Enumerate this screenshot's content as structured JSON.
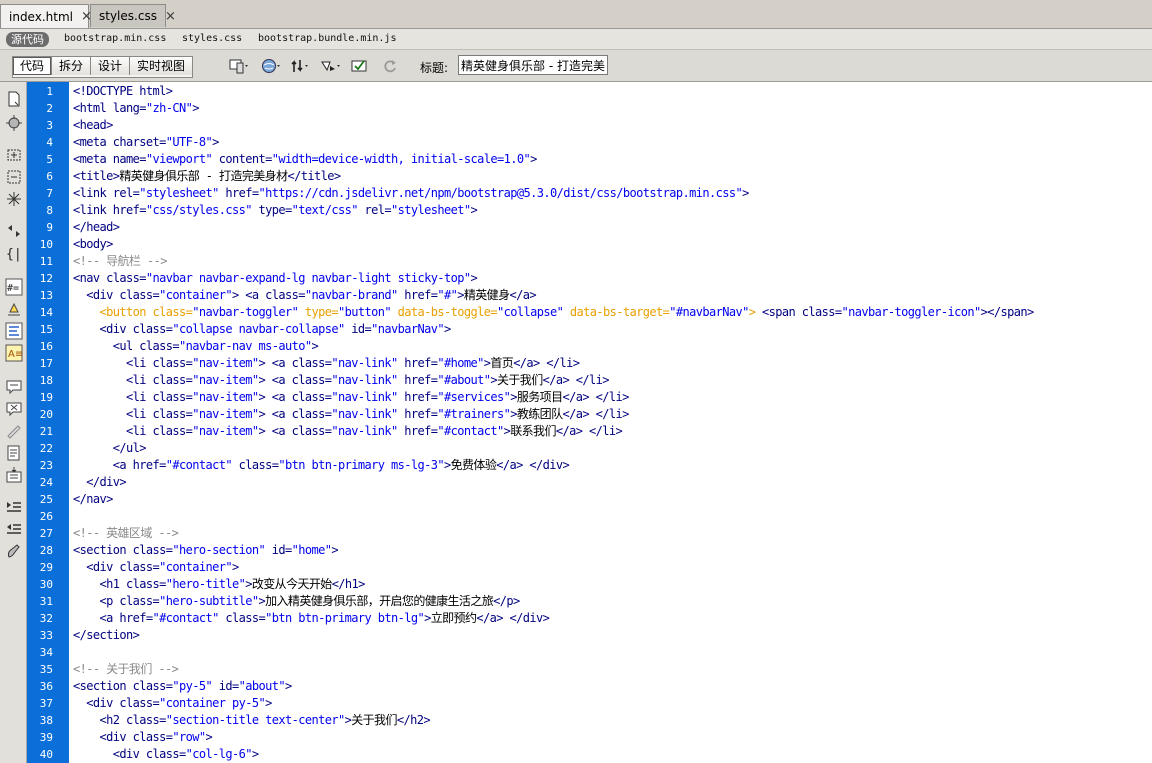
{
  "tabs": [
    {
      "label": "index.html",
      "close": "×",
      "active": true
    },
    {
      "label": "styles.css",
      "close": "×",
      "active": false
    }
  ],
  "related": {
    "source_label": "源代码",
    "files": [
      "bootstrap.min.css",
      "styles.css",
      "bootstrap.bundle.min.js"
    ]
  },
  "toolbar": {
    "views": [
      "代码",
      "拆分",
      "设计",
      "实时视图"
    ],
    "active_view": "代码",
    "title_label": "标题:",
    "title_value": "精英健身俱乐部 - 打造完美身材"
  },
  "editor": {
    "line_numbers": [
      "1",
      "2",
      "3",
      "4",
      "5",
      "6",
      "7",
      "8",
      "9",
      "10",
      "11",
      "12",
      "13",
      "14",
      "15",
      "16",
      "17",
      "18",
      "19",
      "20",
      "21",
      "22",
      "23",
      "24",
      "25",
      "26",
      "27",
      "28",
      "29",
      "30",
      "31",
      "32",
      "33",
      "34",
      "35",
      "36",
      "37",
      "38",
      "39",
      "40"
    ],
    "lines": [
      [
        [
          "t",
          "<!DOCTYPE html>"
        ]
      ],
      [
        [
          "t",
          "<html "
        ],
        [
          "a",
          "lang="
        ],
        [
          "v",
          "\"zh-CN\""
        ],
        [
          "t",
          ">"
        ]
      ],
      [
        [
          "t",
          "<head>"
        ]
      ],
      [
        [
          "t",
          "<meta "
        ],
        [
          "a",
          "charset="
        ],
        [
          "v",
          "\"UTF-8\""
        ],
        [
          "t",
          ">"
        ]
      ],
      [
        [
          "t",
          "<meta "
        ],
        [
          "a",
          "name="
        ],
        [
          "v",
          "\"viewport\" "
        ],
        [
          "a",
          "content="
        ],
        [
          "v",
          "\"width=device-width, initial-scale=1.0\""
        ],
        [
          "t",
          ">"
        ]
      ],
      [
        [
          "t",
          "<title>"
        ],
        [
          "x",
          "精英健身俱乐部 - 打造完美身材"
        ],
        [
          "t",
          "</title>"
        ]
      ],
      [
        [
          "t",
          "<link "
        ],
        [
          "a",
          "rel="
        ],
        [
          "v",
          "\"stylesheet\" "
        ],
        [
          "a",
          "href="
        ],
        [
          "v",
          "\"https://cdn.jsdelivr.net/npm/bootstrap@5.3.0/dist/css/bootstrap.min.css\""
        ],
        [
          "t",
          ">"
        ]
      ],
      [
        [
          "t",
          "<link "
        ],
        [
          "a",
          "href="
        ],
        [
          "v",
          "\"css/styles.css\" "
        ],
        [
          "a",
          "type="
        ],
        [
          "v",
          "\"text/css\" "
        ],
        [
          "a",
          "rel="
        ],
        [
          "v",
          "\"stylesheet\""
        ],
        [
          "t",
          ">"
        ]
      ],
      [
        [
          "t",
          "</head>"
        ]
      ],
      [
        [
          "t",
          "<body>"
        ]
      ],
      [
        [
          "c",
          "<!-- 导航栏 -->"
        ]
      ],
      [
        [
          "t",
          "<nav "
        ],
        [
          "a",
          "class="
        ],
        [
          "v",
          "\"navbar navbar-expand-lg navbar-light sticky-top\""
        ],
        [
          "t",
          ">"
        ]
      ],
      [
        [
          "x",
          "  "
        ],
        [
          "t",
          "<div "
        ],
        [
          "a",
          "class="
        ],
        [
          "v",
          "\"container\""
        ],
        [
          "t",
          "> <a "
        ],
        [
          "a",
          "class="
        ],
        [
          "v",
          "\"navbar-brand\" "
        ],
        [
          "a",
          "href="
        ],
        [
          "v",
          "\"#\""
        ],
        [
          "t",
          ">"
        ],
        [
          "x",
          "精英健身"
        ],
        [
          "t",
          "</a>"
        ]
      ],
      [
        [
          "x",
          "    "
        ],
        [
          "o",
          "<button class="
        ],
        [
          "v",
          "\"navbar-toggler\" "
        ],
        [
          "o",
          "type="
        ],
        [
          "v",
          "\"button\" "
        ],
        [
          "o",
          "data-bs-toggle="
        ],
        [
          "v",
          "\"collapse\" "
        ],
        [
          "o",
          "data-bs-target="
        ],
        [
          "v",
          "\"#navbarNav\""
        ],
        [
          "o",
          ">"
        ],
        [
          "t",
          " <span "
        ],
        [
          "a",
          "class="
        ],
        [
          "v",
          "\"navbar-toggler-icon\""
        ],
        [
          "t",
          "></span>"
        ]
      ],
      [
        [
          "x",
          "    "
        ],
        [
          "t",
          "<div "
        ],
        [
          "a",
          "class="
        ],
        [
          "v",
          "\"collapse navbar-collapse\" "
        ],
        [
          "a",
          "id="
        ],
        [
          "v",
          "\"navbarNav\""
        ],
        [
          "t",
          ">"
        ]
      ],
      [
        [
          "x",
          "      "
        ],
        [
          "t",
          "<ul "
        ],
        [
          "a",
          "class="
        ],
        [
          "v",
          "\"navbar-nav ms-auto\""
        ],
        [
          "t",
          ">"
        ]
      ],
      [
        [
          "x",
          "        "
        ],
        [
          "t",
          "<li "
        ],
        [
          "a",
          "class="
        ],
        [
          "v",
          "\"nav-item\""
        ],
        [
          "t",
          "> <a "
        ],
        [
          "a",
          "class="
        ],
        [
          "v",
          "\"nav-link\" "
        ],
        [
          "a",
          "href="
        ],
        [
          "v",
          "\"#home\""
        ],
        [
          "t",
          ">"
        ],
        [
          "x",
          "首页"
        ],
        [
          "t",
          "</a> </li>"
        ]
      ],
      [
        [
          "x",
          "        "
        ],
        [
          "t",
          "<li "
        ],
        [
          "a",
          "class="
        ],
        [
          "v",
          "\"nav-item\""
        ],
        [
          "t",
          "> <a "
        ],
        [
          "a",
          "class="
        ],
        [
          "v",
          "\"nav-link\" "
        ],
        [
          "a",
          "href="
        ],
        [
          "v",
          "\"#about\""
        ],
        [
          "t",
          ">"
        ],
        [
          "x",
          "关于我们"
        ],
        [
          "t",
          "</a> </li>"
        ]
      ],
      [
        [
          "x",
          "        "
        ],
        [
          "t",
          "<li "
        ],
        [
          "a",
          "class="
        ],
        [
          "v",
          "\"nav-item\""
        ],
        [
          "t",
          "> <a "
        ],
        [
          "a",
          "class="
        ],
        [
          "v",
          "\"nav-link\" "
        ],
        [
          "a",
          "href="
        ],
        [
          "v",
          "\"#services\""
        ],
        [
          "t",
          ">"
        ],
        [
          "x",
          "服务项目"
        ],
        [
          "t",
          "</a> </li>"
        ]
      ],
      [
        [
          "x",
          "        "
        ],
        [
          "t",
          "<li "
        ],
        [
          "a",
          "class="
        ],
        [
          "v",
          "\"nav-item\""
        ],
        [
          "t",
          "> <a "
        ],
        [
          "a",
          "class="
        ],
        [
          "v",
          "\"nav-link\" "
        ],
        [
          "a",
          "href="
        ],
        [
          "v",
          "\"#trainers\""
        ],
        [
          "t",
          ">"
        ],
        [
          "x",
          "教练团队"
        ],
        [
          "t",
          "</a> </li>"
        ]
      ],
      [
        [
          "x",
          "        "
        ],
        [
          "t",
          "<li "
        ],
        [
          "a",
          "class="
        ],
        [
          "v",
          "\"nav-item\""
        ],
        [
          "t",
          "> <a "
        ],
        [
          "a",
          "class="
        ],
        [
          "v",
          "\"nav-link\" "
        ],
        [
          "a",
          "href="
        ],
        [
          "v",
          "\"#contact\""
        ],
        [
          "t",
          ">"
        ],
        [
          "x",
          "联系我们"
        ],
        [
          "t",
          "</a> </li>"
        ]
      ],
      [
        [
          "x",
          "      "
        ],
        [
          "t",
          "</ul>"
        ]
      ],
      [
        [
          "x",
          "      "
        ],
        [
          "t",
          "<a "
        ],
        [
          "a",
          "href="
        ],
        [
          "v",
          "\"#contact\" "
        ],
        [
          "a",
          "class="
        ],
        [
          "v",
          "\"btn btn-primary ms-lg-3\""
        ],
        [
          "t",
          ">"
        ],
        [
          "x",
          "免费体验"
        ],
        [
          "t",
          "</a> </div>"
        ]
      ],
      [
        [
          "x",
          "  "
        ],
        [
          "t",
          "</div>"
        ]
      ],
      [
        [
          "t",
          "</nav>"
        ]
      ],
      [
        [
          "x",
          ""
        ]
      ],
      [
        [
          "c",
          "<!-- 英雄区域 -->"
        ]
      ],
      [
        [
          "t",
          "<section "
        ],
        [
          "a",
          "class="
        ],
        [
          "v",
          "\"hero-section\" "
        ],
        [
          "a",
          "id="
        ],
        [
          "v",
          "\"home\""
        ],
        [
          "t",
          ">"
        ]
      ],
      [
        [
          "x",
          "  "
        ],
        [
          "t",
          "<div "
        ],
        [
          "a",
          "class="
        ],
        [
          "v",
          "\"container\""
        ],
        [
          "t",
          ">"
        ]
      ],
      [
        [
          "x",
          "    "
        ],
        [
          "t",
          "<h1 "
        ],
        [
          "a",
          "class="
        ],
        [
          "v",
          "\"hero-title\""
        ],
        [
          "t",
          ">"
        ],
        [
          "x",
          "改变从今天开始"
        ],
        [
          "t",
          "</h1>"
        ]
      ],
      [
        [
          "x",
          "    "
        ],
        [
          "t",
          "<p "
        ],
        [
          "a",
          "class="
        ],
        [
          "v",
          "\"hero-subtitle\""
        ],
        [
          "t",
          ">"
        ],
        [
          "x",
          "加入精英健身俱乐部，开启您的健康生活之旅"
        ],
        [
          "t",
          "</p>"
        ]
      ],
      [
        [
          "x",
          "    "
        ],
        [
          "t",
          "<a "
        ],
        [
          "a",
          "href="
        ],
        [
          "v",
          "\"#contact\" "
        ],
        [
          "a",
          "class="
        ],
        [
          "v",
          "\"btn btn-primary btn-lg\""
        ],
        [
          "t",
          ">"
        ],
        [
          "x",
          "立即预约"
        ],
        [
          "t",
          "</a> </div>"
        ]
      ],
      [
        [
          "t",
          "</section>"
        ]
      ],
      [
        [
          "x",
          ""
        ]
      ],
      [
        [
          "c",
          "<!-- 关于我们 -->"
        ]
      ],
      [
        [
          "t",
          "<section "
        ],
        [
          "a",
          "class="
        ],
        [
          "v",
          "\"py-5\" "
        ],
        [
          "a",
          "id="
        ],
        [
          "v",
          "\"about\""
        ],
        [
          "t",
          ">"
        ]
      ],
      [
        [
          "x",
          "  "
        ],
        [
          "t",
          "<div "
        ],
        [
          "a",
          "class="
        ],
        [
          "v",
          "\"container py-5\""
        ],
        [
          "t",
          ">"
        ]
      ],
      [
        [
          "x",
          "    "
        ],
        [
          "t",
          "<h2 "
        ],
        [
          "a",
          "class="
        ],
        [
          "v",
          "\"section-title text-center\""
        ],
        [
          "t",
          ">"
        ],
        [
          "x",
          "关于我们"
        ],
        [
          "t",
          "</h2>"
        ]
      ],
      [
        [
          "x",
          "    "
        ],
        [
          "t",
          "<div "
        ],
        [
          "a",
          "class="
        ],
        [
          "v",
          "\"row\""
        ],
        [
          "t",
          ">"
        ]
      ],
      [
        [
          "x",
          "      "
        ],
        [
          "t",
          "<div "
        ],
        [
          "a",
          "class="
        ],
        [
          "v",
          "\"col-lg-6\""
        ],
        [
          "t",
          ">"
        ]
      ]
    ]
  },
  "icons": {
    "toolbar": [
      "multiscreen-icon",
      "preview-browser-icon",
      "file-management-icon",
      "inspect-icon",
      "validate-icon",
      "refresh-icon"
    ],
    "sidebar": [
      "open-documents-icon",
      "show-code-navigator-icon",
      "collapse-full-tag-icon",
      "collapse-selection-icon",
      "expand-all-icon",
      "select-parent-tag-icon",
      "balance-braces-icon",
      "line-numbers-icon",
      "highlight-invalid-code-icon",
      "syntax-coloring-icon",
      "info-code-hint-icon",
      "apply-comment-icon",
      "remove-comment-icon",
      "wrap-tag-icon",
      "recent-snippets-icon",
      "move-css-icon",
      "indent-code-icon",
      "outdent-code-icon",
      "format-source-icon"
    ]
  }
}
